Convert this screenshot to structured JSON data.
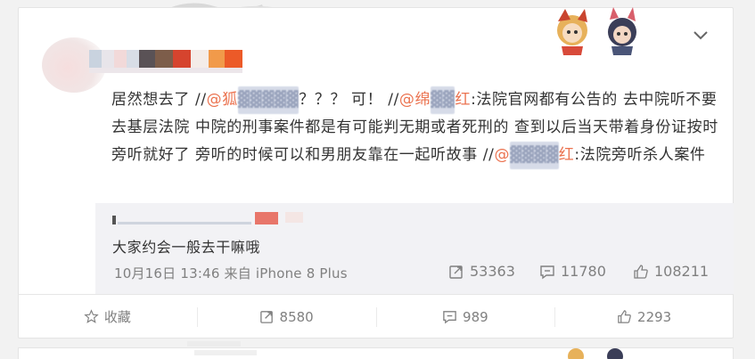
{
  "post": {
    "text_prefix": "居然想去了 //",
    "mention1": "@狐",
    "mention1_redacted": "▓▓▓▓▓",
    "text_mid1": "？？？ 可！ //",
    "mention2": "@绵",
    "mention2_redacted": "▓▓",
    "mention2_suffix": "红",
    "text_main": ":法院官网都有公告的 去中院听不要去基层法院 中院的刑事案件都是有可能判无期或者死刑的 查到以后当天带着身份证按时旁听就好了 旁听的时候可以和男朋友靠在一起听故事 //",
    "mention3": "@",
    "mention3_redacted": "▓▓▓▓",
    "mention3_suffix": "红",
    "text_end": ":法院旁听杀人案件"
  },
  "quote": {
    "text": "大家约会一般去干嘛哦",
    "meta": "10月16日 13:46 来自 iPhone 8 Plus",
    "reposts": "53363",
    "comments": "11780",
    "likes": "108211"
  },
  "actions": {
    "favorite": "收藏",
    "repost": "8580",
    "comment": "989",
    "like": "2293"
  },
  "icons": [
    "chevron-down-icon",
    "star-icon",
    "repost-icon",
    "comment-icon",
    "thumbs-up-icon"
  ],
  "colors": {
    "mention": "#eb7350",
    "meta_gray": "#808080",
    "quote_bg": "#f2f2f5"
  }
}
